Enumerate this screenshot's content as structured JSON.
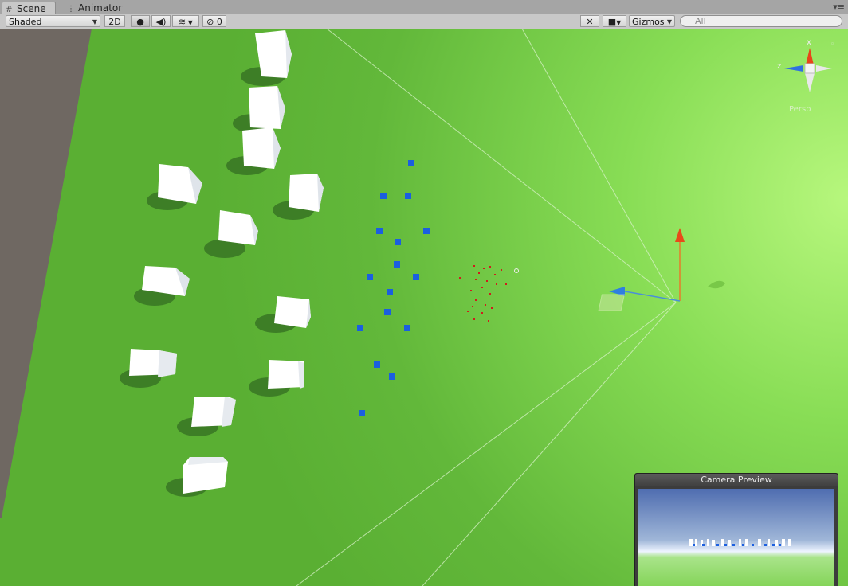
{
  "tabs": [
    {
      "label": "Scene",
      "icon": "grid-icon",
      "active": true
    },
    {
      "label": "Animator",
      "icon": "animator-icon",
      "active": false
    }
  ],
  "toolbar": {
    "draw_mode": "Shaded",
    "mode_2d": "2D",
    "hidden_count": "0",
    "gizmos": "Gizmos",
    "search_placeholder": "All"
  },
  "gizmo": {
    "projection": "Persp",
    "axis_x": "x",
    "axis_z": "z"
  },
  "camera_preview": {
    "title": "Camera Preview"
  },
  "colors": {
    "ground": "#5fb536",
    "ground_light": "#b4f57a",
    "cube": "#ffffff",
    "agent": "#1b5fe0",
    "particle": "#d01c1c"
  }
}
